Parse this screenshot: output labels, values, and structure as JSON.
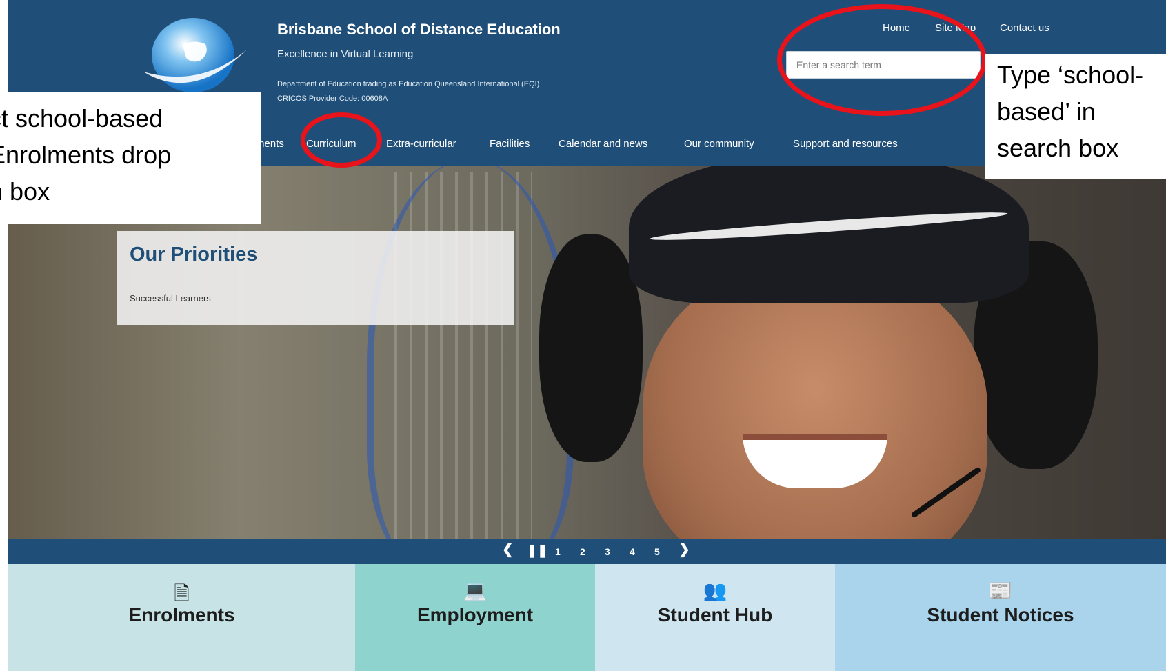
{
  "header": {
    "site_title": "Brisbane School of Distance Education",
    "tagline": "Excellence in Virtual Learning",
    "department_line": "Department of Education trading as Education Queensland International (EQI)",
    "cricos_line": "CRICOS Provider Code: 00608A",
    "utility_links": {
      "home": "Home",
      "site_map": "Site Map",
      "contact": "Contact us"
    },
    "search": {
      "placeholder": "Enter a search term",
      "value": ""
    }
  },
  "nav": {
    "items": [
      "Enrolments",
      "Curriculum",
      "Extra-curricular",
      "Facilities",
      "Calendar and news",
      "Our community",
      "Support and resources"
    ]
  },
  "hero": {
    "priorities_title": "Our Priorities",
    "priorities_subtitle": "Successful Learners"
  },
  "slider": {
    "prev_icon": "chevron-left-icon",
    "pause_icon": "pause-icon",
    "next_icon": "chevron-right-icon",
    "pages": [
      "1",
      "2",
      "3",
      "4",
      "5"
    ]
  },
  "quick_links": [
    {
      "label": "Enrolments",
      "icon": "document-icon",
      "color": "#c7e3e6"
    },
    {
      "label": "Employment",
      "icon": "laptop-icon",
      "color": "#8fd3cf"
    },
    {
      "label": "Student Hub",
      "icon": "users-icon",
      "color": "#cfe6f0"
    },
    {
      "label": "Student Notices",
      "icon": "newspaper-icon",
      "color": "#a9d4ec"
    }
  ],
  "annotations": {
    "left_callout": [
      "ct school-based",
      " Enrolments drop",
      "n box"
    ],
    "right_callout": [
      "Type ‘school-",
      "based’ in",
      "search box"
    ]
  },
  "colors": {
    "header_bg": "#1f4f78",
    "annotation_ring": "#e8131b"
  }
}
